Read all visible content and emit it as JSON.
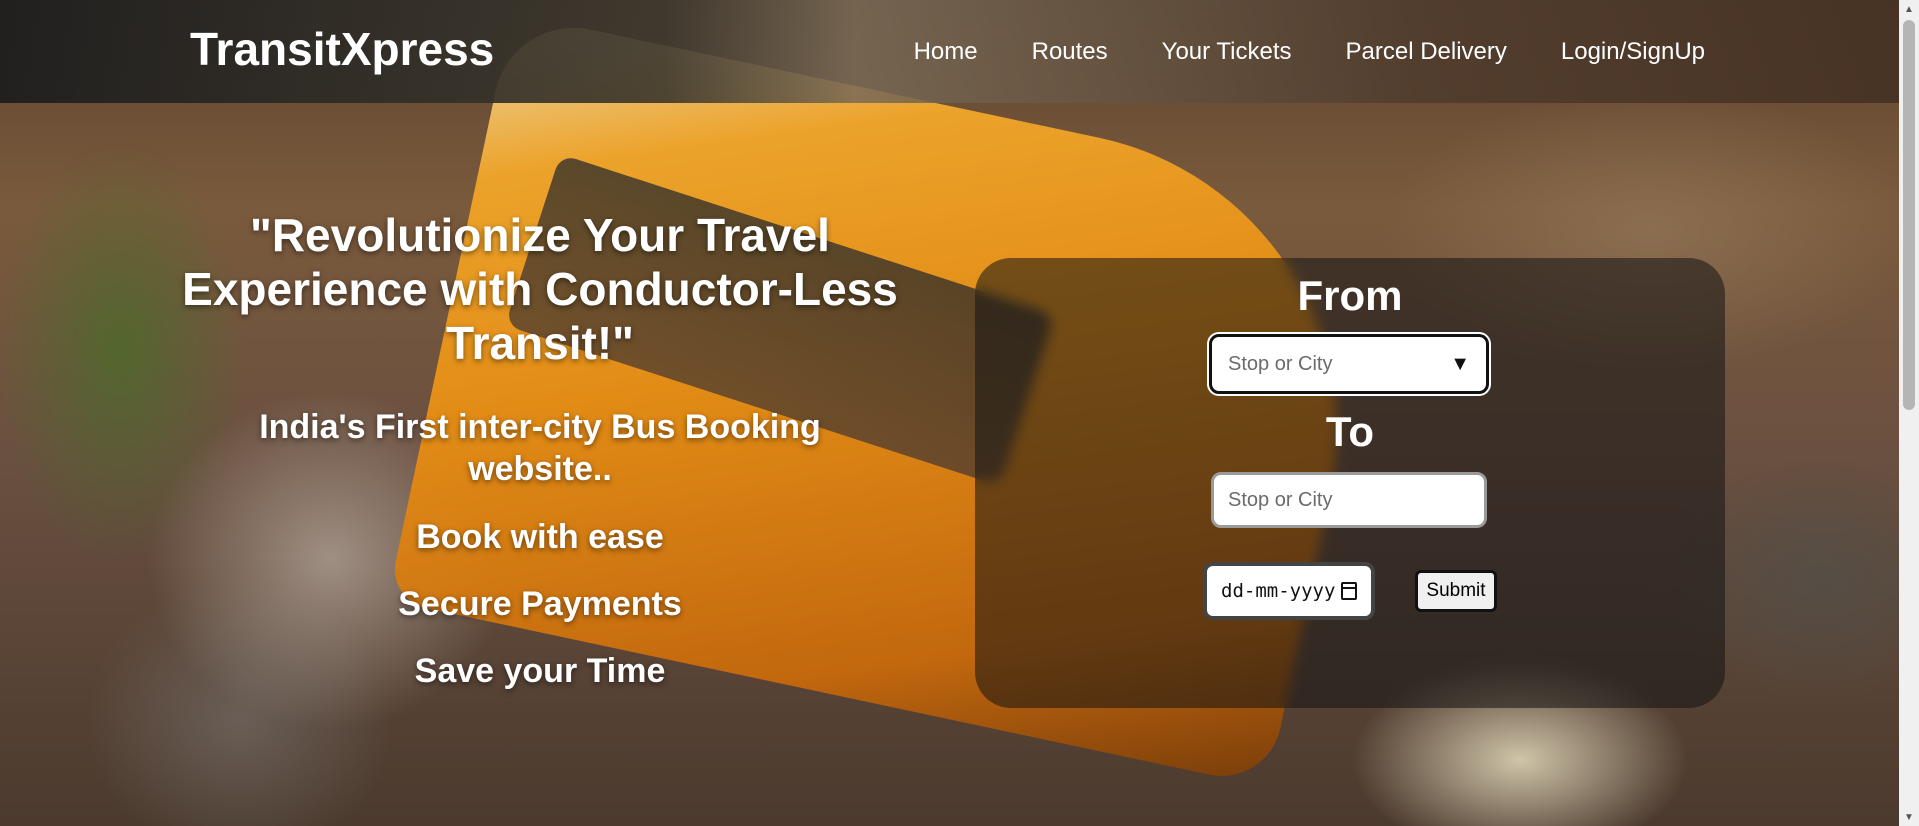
{
  "brand": "TransitXpress",
  "nav": {
    "home": "Home",
    "routes": "Routes",
    "tickets": "Your Tickets",
    "parcel": "Parcel Delivery",
    "login": "Login/SignUp"
  },
  "hero": {
    "headline": "\"Revolutionize Your Travel Experience with Conductor-Less Transit!\"",
    "subheadline": "India's First inter-city Bus Booking website..",
    "features": [
      "Book with ease",
      "Secure Payments",
      "Save your Time"
    ]
  },
  "booking": {
    "from_label": "From",
    "from_placeholder": "Stop or City",
    "to_label": "To",
    "to_placeholder": "Stop or City",
    "date_placeholder": "dd-mm-yyyy",
    "submit_label": "Submit"
  },
  "icons": {
    "dropdown": "chevron-down-icon",
    "calendar": "calendar-icon"
  }
}
